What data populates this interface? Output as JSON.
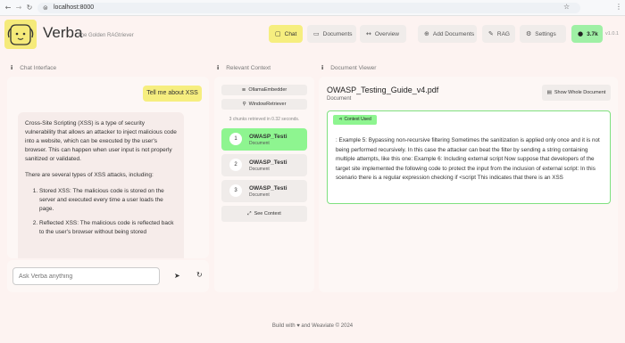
{
  "browser": {
    "url": "localhost:8000"
  },
  "header": {
    "title": "Verba",
    "subtitle": "The Golden RAGtriever",
    "buttons": [
      {
        "label": "Chat",
        "icon": "chat-icon"
      },
      {
        "label": "Documents",
        "icon": "documents-icon"
      },
      {
        "label": "Overview",
        "icon": "overview-icon"
      },
      {
        "label": "Add Documents",
        "icon": "plus-icon"
      },
      {
        "label": "RAG",
        "icon": "wrench-icon"
      },
      {
        "label": "Settings",
        "icon": "gear-icon"
      }
    ],
    "github_count": "3.7k",
    "version": "v1.0.1"
  },
  "sections": {
    "chat": "Chat Interface",
    "context": "Relevant Context",
    "viewer": "Document Viewer"
  },
  "chat": {
    "user_message": "Tell me about XSS",
    "bot_paragraphs": [
      "Cross-Site Scripting (XSS) is a type of security vulnerability that allows an attacker to inject malicious code into a website, which can be executed by the user's browser. This can happen when user input is not properly sanitized or validated.",
      "There are several types of XSS attacks, including:"
    ],
    "bot_list": [
      "Stored XSS: The malicious code is stored on the server and executed every time a user loads the page.",
      "Reflected XSS: The malicious code is reflected back to the user's browser without being stored"
    ],
    "input_placeholder": "Ask Verba anything"
  },
  "context": {
    "embedder": "OllamaEmbedder",
    "retriever": "WindowRetriever",
    "info": "3 chunks retrieved in 0.32 seconds.",
    "chunks": [
      {
        "num": "1",
        "title": "OWASP_Testi",
        "type": "Document"
      },
      {
        "num": "2",
        "title": "OWASP_Testi",
        "type": "Document"
      },
      {
        "num": "3",
        "title": "OWASP_Testi",
        "type": "Document"
      }
    ],
    "see_context": "See Context"
  },
  "viewer": {
    "title": "OWASP_Testing_Guide_v4.pdf",
    "subtitle": "Document",
    "show_whole": "Show Whole Document",
    "badge": "Context Used",
    "text": ": Example 5: Bypassing non-recursive filtering Sometimes the sanitization is applied only once and it is not being performed recursively. In this case the attacker can beat the filter by sending a string containing multiple attempts, like this one: Example 6: Including external script Now suppose that developers of the target site implemented the following code to protect the input from the inclusion of external script: In this scenario there is a regular expression checking if <script This indicates that there is an XSS"
  },
  "footer": "Build with ♥ and Weaviate © 2024",
  "colors": {
    "active": "#f6ee7f",
    "green": "#8ef590",
    "background": "#fdf3f1"
  }
}
